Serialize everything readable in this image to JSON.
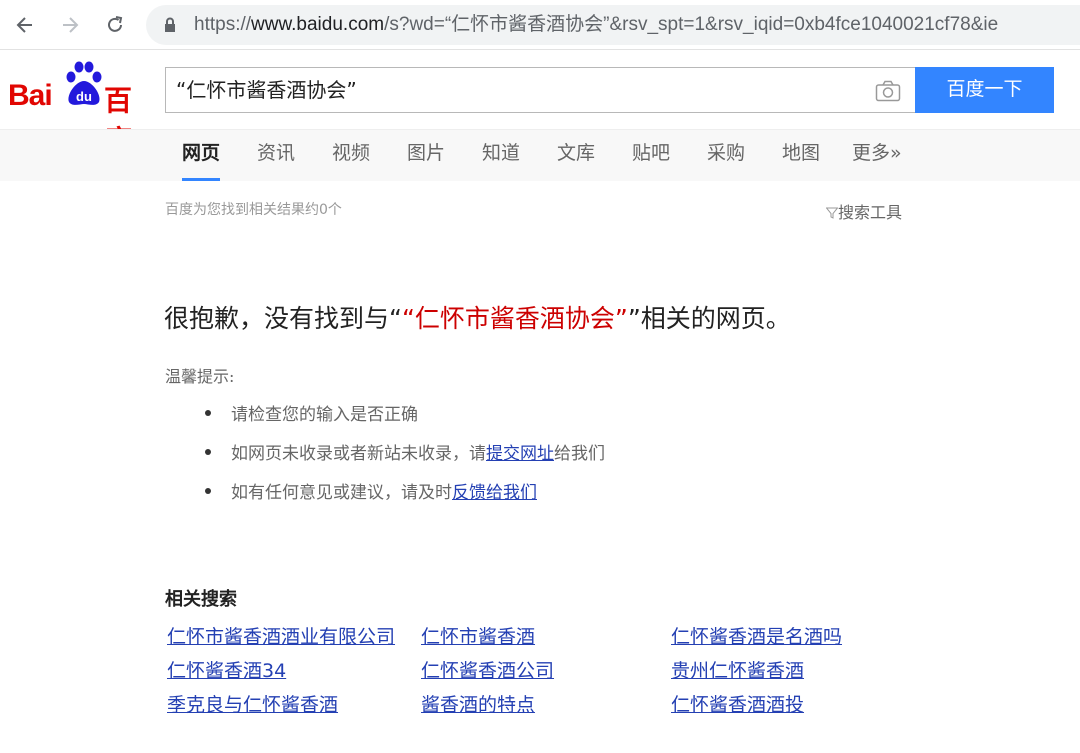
{
  "browser": {
    "url_scheme": "https://",
    "url_host": "www.baidu.com",
    "url_path": "/s?wd=“仁怀市酱香酒协会”&rsv_spt=1&rsv_iqid=0xb4fce1040021cf78&ie"
  },
  "header": {
    "logo_bai": "Bai",
    "logo_du": "du",
    "logo_cn": "百度",
    "query": "“仁怀市酱香酒协会”",
    "search_button": "百度一下"
  },
  "tabs": [
    "网页",
    "资讯",
    "视频",
    "图片",
    "知道",
    "文库",
    "贴吧",
    "采购",
    "地图",
    "更多»"
  ],
  "results": {
    "count_text": "百度为您找到相关结果约0个",
    "tools_label": "搜索工具"
  },
  "sorry": {
    "prefix": "很抱歉，没有找到与“",
    "query": "“仁怀市酱香酒协会”",
    "suffix": "”相关的网页。"
  },
  "tips": {
    "title": "温馨提示:",
    "item1": "请检查您的输入是否正确",
    "item2_prefix": "如网页未收录或者新站未收录，请",
    "item2_link": "提交网址",
    "item2_suffix": "给我们",
    "item3_prefix": "如有任何意见或建议，请及时",
    "item3_link": "反馈给我们"
  },
  "related": {
    "title": "相关搜索",
    "items": [
      "仁怀市酱香酒酒业有限公司",
      "仁怀市酱香酒",
      "仁怀酱香酒是名酒吗",
      "仁怀酱香酒34",
      "仁怀酱香酒公司",
      "贵州仁怀酱香酒",
      "季克良与仁怀酱香酒",
      "酱香酒的特点",
      "仁怀酱香酒酒投"
    ]
  },
  "colors": {
    "brand_red": "#e10602",
    "brand_blue": "#3385ff",
    "link": "#2440b3",
    "query_red": "#cc0000"
  }
}
